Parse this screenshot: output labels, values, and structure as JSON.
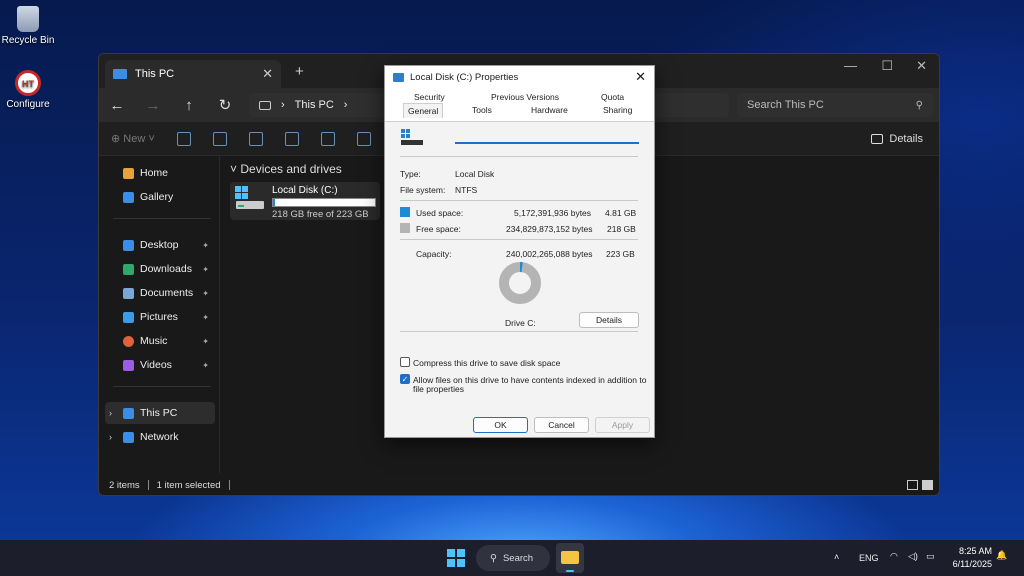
{
  "desktop": {
    "recycle_bin": "Recycle Bin",
    "configure": "Configure",
    "configure_logo_text": "HT"
  },
  "explorer": {
    "tab_title": "This PC",
    "address": "This PC",
    "search_placeholder": "Search This PC",
    "new_label": "New",
    "details_label": "Details",
    "group_heading": "Devices and drives",
    "drive": {
      "name": "Local Disk (C:)",
      "free_text": "218 GB free of 223 GB",
      "used_fraction": 0.02
    },
    "sidebar": {
      "home": "Home",
      "gallery": "Gallery",
      "desktop": "Desktop",
      "downloads": "Downloads",
      "documents": "Documents",
      "pictures": "Pictures",
      "music": "Music",
      "videos": "Videos",
      "this_pc": "This PC",
      "network": "Network"
    },
    "status": {
      "items": "2 items",
      "selected": "1 item selected"
    }
  },
  "dialog": {
    "title": "Local Disk (C:) Properties",
    "tabs": {
      "security": "Security",
      "previous_versions": "Previous Versions",
      "quota": "Quota",
      "general": "General",
      "tools": "Tools",
      "hardware": "Hardware",
      "sharing": "Sharing"
    },
    "name_value": "",
    "type_label": "Type:",
    "type_value": "Local Disk",
    "fs_label": "File system:",
    "fs_value": "NTFS",
    "used_label": "Used space:",
    "used_bytes": "5,172,391,936 bytes",
    "used_gb": "4.81 GB",
    "free_label": "Free space:",
    "free_bytes": "234,829,873,152 bytes",
    "free_gb": "218 GB",
    "capacity_label": "Capacity:",
    "capacity_bytes": "240,002,265,088 bytes",
    "capacity_gb": "223 GB",
    "drive_label": "Drive C:",
    "details_button": "Details",
    "compress_label": "Compress this drive to save disk space",
    "compress_checked": false,
    "index_label_1": "Allow files on this drive to have contents indexed in addition to",
    "index_label_2": "file properties",
    "index_checked": true,
    "ok": "OK",
    "cancel": "Cancel",
    "apply": "Apply",
    "used_fraction": 0.0216,
    "colors": {
      "used": "#1f8ad6",
      "free": "#b4b4b4"
    }
  },
  "taskbar": {
    "search": "Search",
    "language": "ENG",
    "time": "8:25 AM",
    "date": "6/11/2025"
  }
}
